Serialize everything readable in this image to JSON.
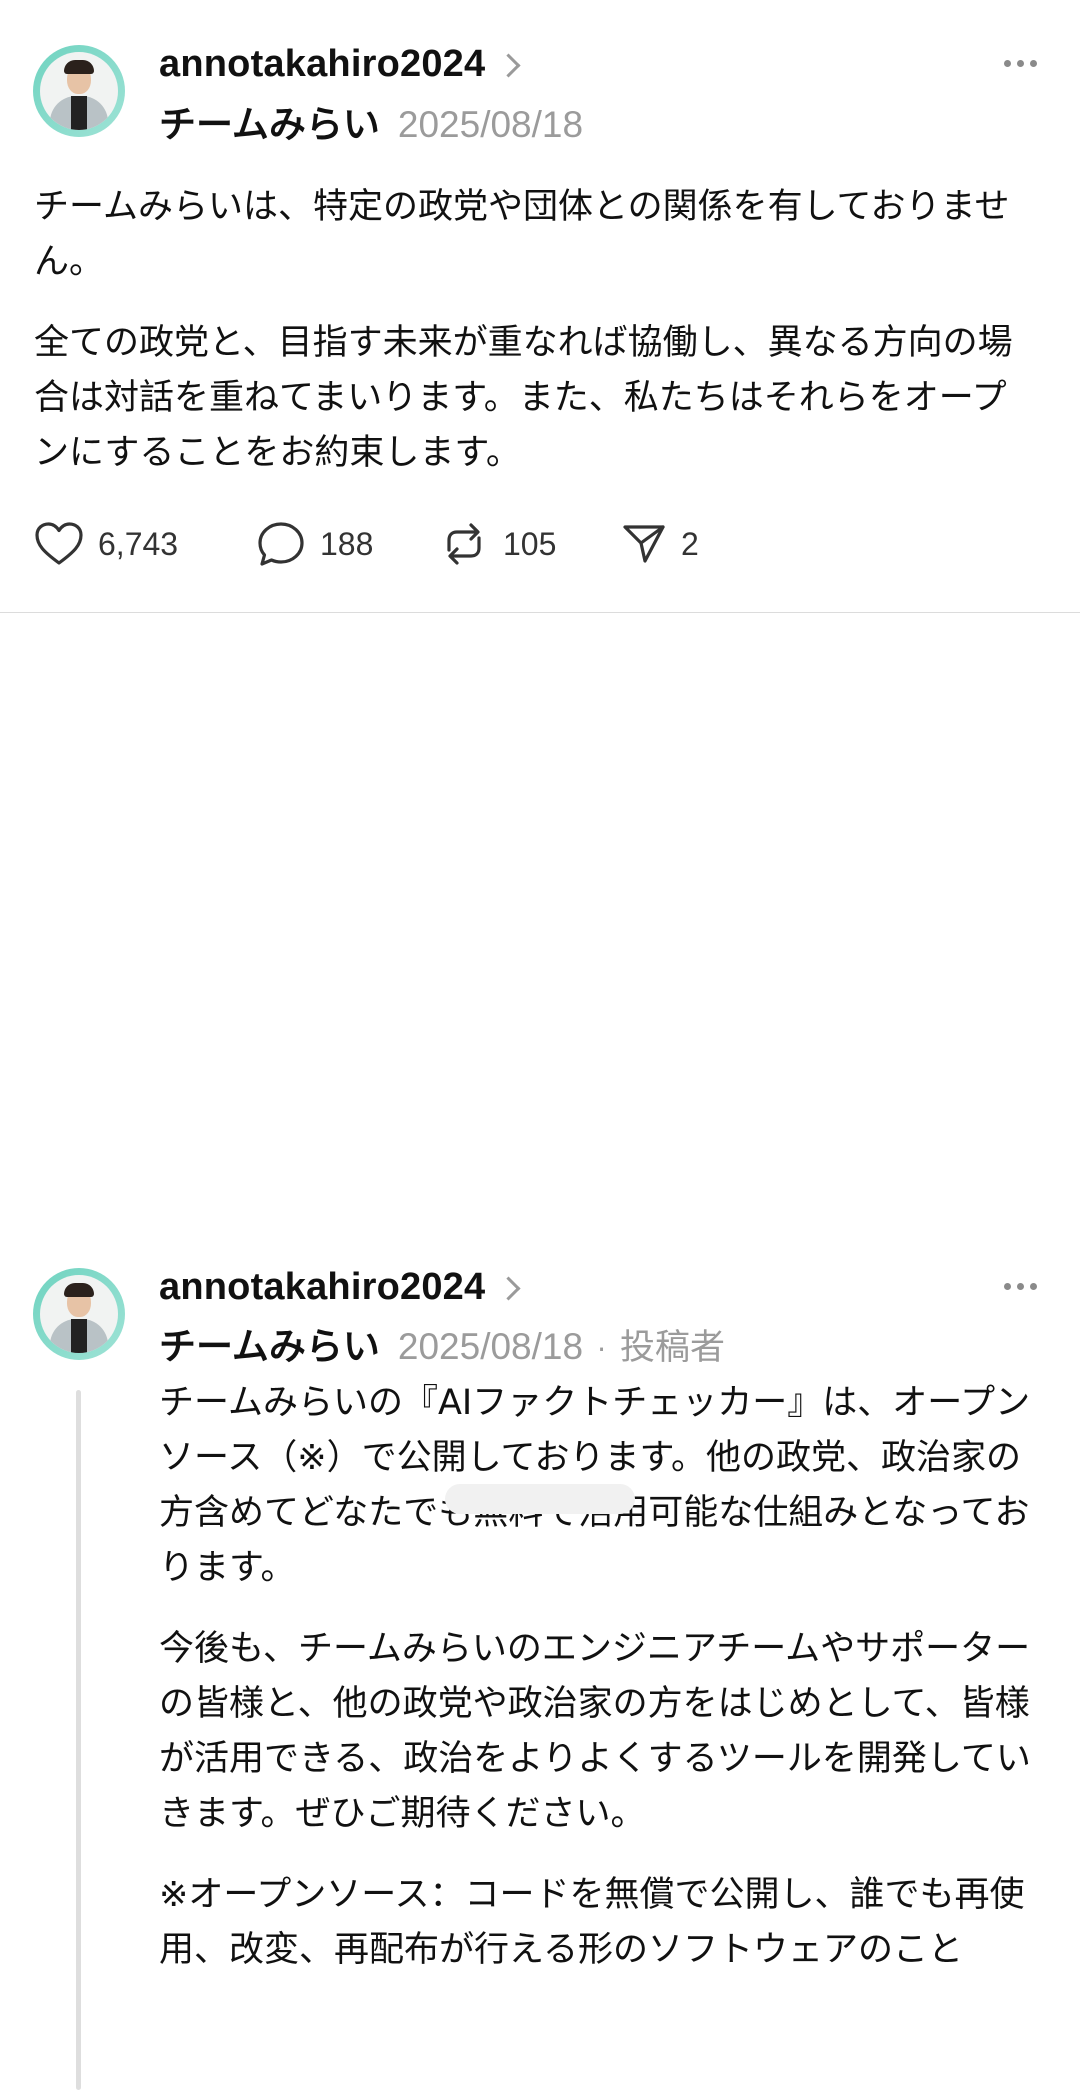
{
  "posts": [
    {
      "username": "annotakahiro2024",
      "display_name": "チームみらい",
      "date": "2025/08/18",
      "paragraphs": [
        "チームみらいは、特定の政党や団体との関係を有しておりません。",
        "全ての政党と、目指す未来が重なれば協働し、異なる方向の場合は対話を重ねてまいります。また、私たちはそれらをオープンにすることをお約束します。"
      ],
      "actions": {
        "likes": "6,743",
        "replies": "188",
        "reposts": "105",
        "shares": "2"
      }
    },
    {
      "username": "annotakahiro2024",
      "display_name": "チームみらい",
      "date": "2025/08/18",
      "separator": "·",
      "author_badge": "投稿者",
      "paragraphs": [
        "チームみらいの『AIファクトチェッカー』は、オープンソース（※）で公開しております。他の政党、政治家の方含めてどなたでも無料で活用可能な仕組みとなっております。",
        "今後も、チームみらいのエンジニアチームやサポーターの皆様と、他の政党や政治家の方をはじめとして、皆様が活用できる、政治をよりよくするツールを開発していきます。ぜひご期待ください。",
        "※オープンソース：コードを無償で公開し、誰でも再使用、改変、再配布が行える形のソフトウェアのこと"
      ]
    }
  ],
  "icons": {
    "like": "heart-icon",
    "reply": "comment-icon",
    "repost": "repost-icon",
    "share": "send-icon",
    "more": "more-dots-icon",
    "profile": "chevron-right-icon"
  }
}
